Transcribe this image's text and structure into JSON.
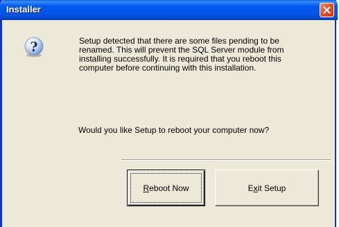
{
  "window": {
    "title": "Installer",
    "close_icon": "close-icon",
    "accent_color": "#0054E3"
  },
  "dialog": {
    "icon": "question-icon",
    "message": "Setup detected that there are some files pending to be renamed. This will prevent the SQL Server module from installing successfully. It is required that you reboot this computer before continuing with this installation.",
    "prompt": "Would you like Setup to reboot your computer now?"
  },
  "buttons": {
    "reboot": {
      "label": "Reboot Now",
      "mnemonic": "R",
      "rest": "eboot Now"
    },
    "exit": {
      "label": "Exit Setup",
      "prefix": "E",
      "mnemonic": "x",
      "rest": "it Setup"
    }
  }
}
